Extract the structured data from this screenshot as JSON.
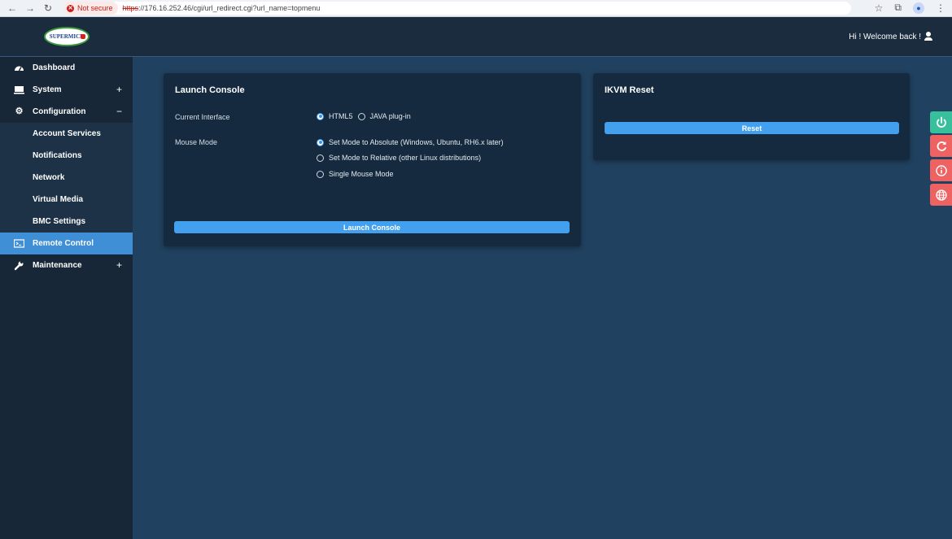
{
  "browser": {
    "security_label": "Not secure",
    "url_scheme": "https",
    "url_rest": "://176.16.252.46/cgi/url_redirect.cgi?url_name=topmenu"
  },
  "header": {
    "logo_text": "SUPERMICR",
    "welcome": "Hi ! Welcome back !"
  },
  "sidebar": {
    "items": [
      {
        "label": "Dashboard",
        "icon": "dashboard-icon"
      },
      {
        "label": "System",
        "icon": "monitor-icon",
        "toggle": "+"
      },
      {
        "label": "Configuration",
        "icon": "gear-icon",
        "toggle": "−"
      },
      {
        "label": "Account Services"
      },
      {
        "label": "Notifications"
      },
      {
        "label": "Network"
      },
      {
        "label": "Virtual Media"
      },
      {
        "label": "BMC Settings"
      },
      {
        "label": "Remote Control",
        "icon": "terminal-icon",
        "active": true
      },
      {
        "label": "Maintenance",
        "icon": "wrench-icon",
        "toggle": "+"
      }
    ]
  },
  "launch_console": {
    "title": "Launch Console",
    "current_interface_label": "Current Interface",
    "interface_options": [
      "HTML5",
      "JAVA plug-in"
    ],
    "interface_selected": "HTML5",
    "mouse_mode_label": "Mouse Mode",
    "mouse_mode_options": [
      "Set Mode to Absolute (Windows, Ubuntu, RH6.x later)",
      "Set Mode to Relative (other Linux distributions)",
      "Single Mouse Mode"
    ],
    "mouse_mode_selected": "Set Mode to Absolute (Windows, Ubuntu, RH6.x later)",
    "button_label": "Launch Console"
  },
  "ikvm_reset": {
    "title": "IKVM Reset",
    "button_label": "Reset"
  },
  "side_actions": [
    "power-icon",
    "refresh-icon",
    "info-icon",
    "globe-icon"
  ],
  "colors": {
    "accent": "#43a0ee",
    "active_nav": "#3e8fd6",
    "power": "#37c09b",
    "danger": "#ef6262"
  }
}
